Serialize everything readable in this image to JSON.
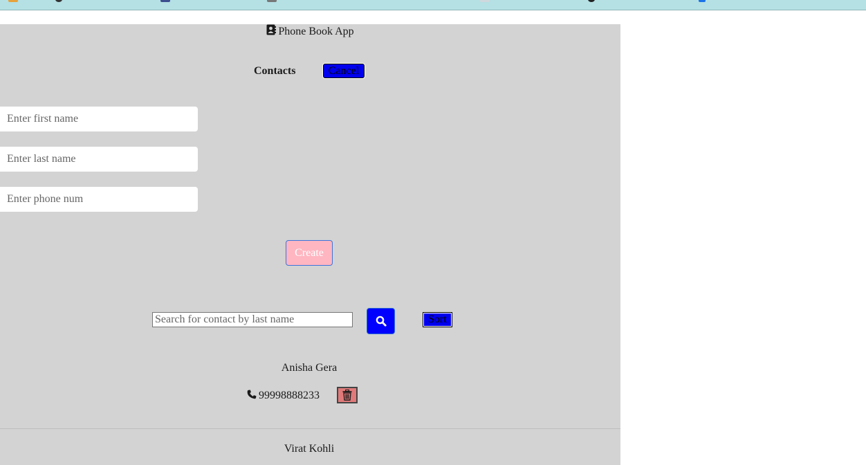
{
  "app": {
    "title": "Phone Book App",
    "contacts_label": "Contacts",
    "cancel_label": "Cancel"
  },
  "form": {
    "first_name_placeholder": "Enter first name",
    "last_name_placeholder": "Enter last name",
    "phone_placeholder": "Enter phone num",
    "create_label": "Create"
  },
  "search": {
    "placeholder": "Search for contact by last name",
    "sort_label": "Sort"
  },
  "contacts": [
    {
      "name": "Anisha Gera",
      "phone": "99998888233"
    },
    {
      "name": "Virat Kohli"
    }
  ],
  "colors": {
    "app_background": "#d3d3d3",
    "bookmarks_bar": "#b5e0e4",
    "primary_button": "#0000ff",
    "create_button": "#ffb6c1",
    "delete_button": "#e07a7a"
  },
  "icons": {
    "title": "address-book-icon",
    "search": "search-icon",
    "phone": "phone-icon",
    "delete": "trash-icon"
  }
}
